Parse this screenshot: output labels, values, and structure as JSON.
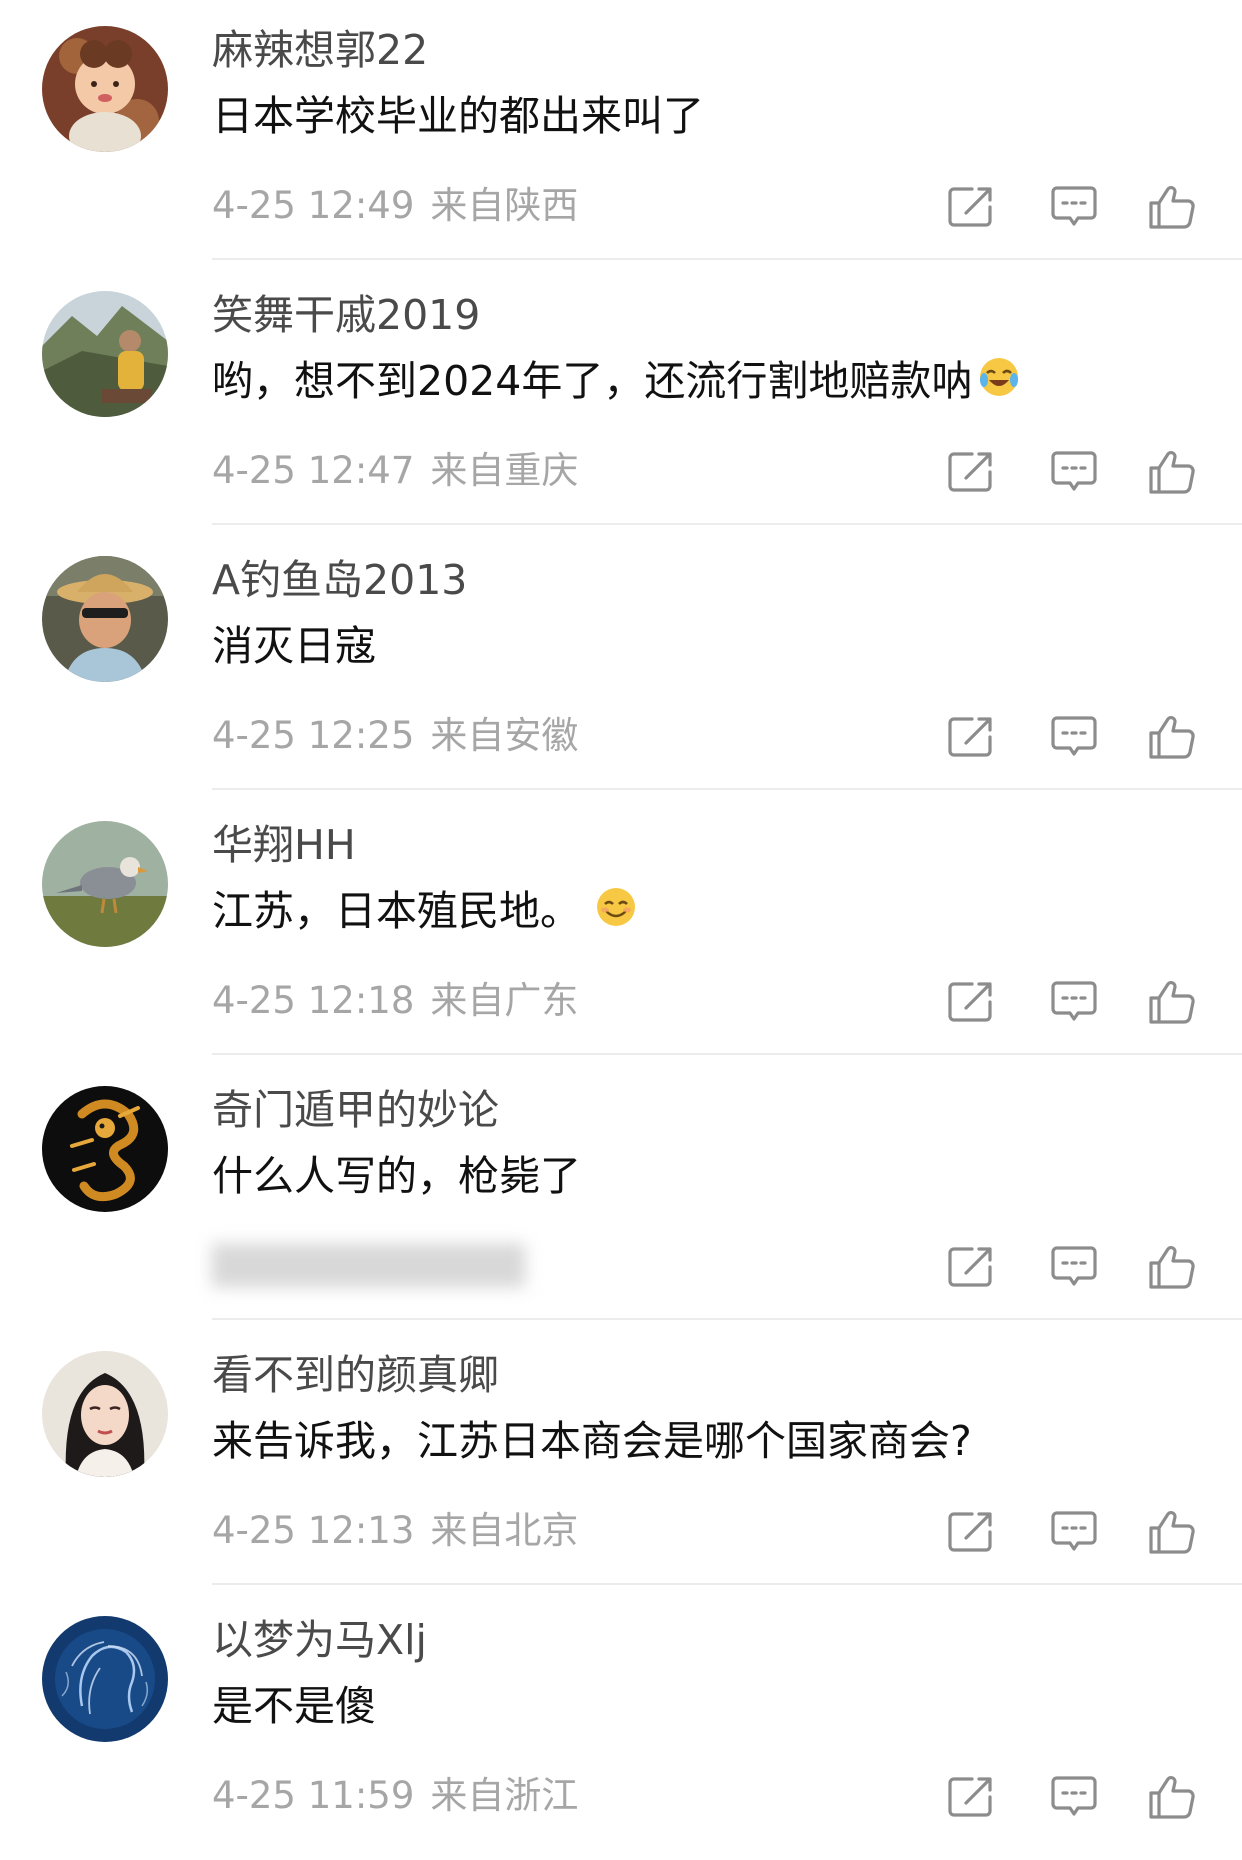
{
  "comments": [
    {
      "user": "麻辣想郭22",
      "text": "日本学校毕业的都出来叫了",
      "time": "4-25 12:49",
      "location": "来自陕西"
    },
    {
      "user": "笑舞干戚2019",
      "text": "哟，想不到2024年了，还流行割地赔款呐",
      "emoji": "laugh-cry-emoji",
      "time": "4-25 12:47",
      "location": "来自重庆"
    },
    {
      "user": "A钓鱼岛2013",
      "text": "消灭日寇",
      "time": "4-25 12:25",
      "location": "来自安徽"
    },
    {
      "user": "华翔HH",
      "text": "江苏，日本殖民地。",
      "emoji": "smile-emoji",
      "time": "4-25 12:18",
      "location": "来自广东"
    },
    {
      "user": "奇门遁甲的妙论",
      "text": "什么人写的，枪毙了",
      "time": "",
      "location": "",
      "meta_blurred": true
    },
    {
      "user": "看不到的颜真卿",
      "text": "来告诉我，江苏日本商会是哪个国家商会?",
      "time": "4-25 12:13",
      "location": "来自北京"
    },
    {
      "user": "以梦为马Xlj",
      "text": "是不是傻",
      "time": "4-25 11:59",
      "location": "来自浙江"
    }
  ],
  "icons": {
    "share": "share-icon",
    "reply": "comment-icon",
    "like": "thumbs-up-icon"
  },
  "colors": {
    "username": "#4a4a4a",
    "text": "#111111",
    "meta": "#a6a6a6",
    "icon": "#8c8c8c",
    "divider": "#ececec"
  }
}
